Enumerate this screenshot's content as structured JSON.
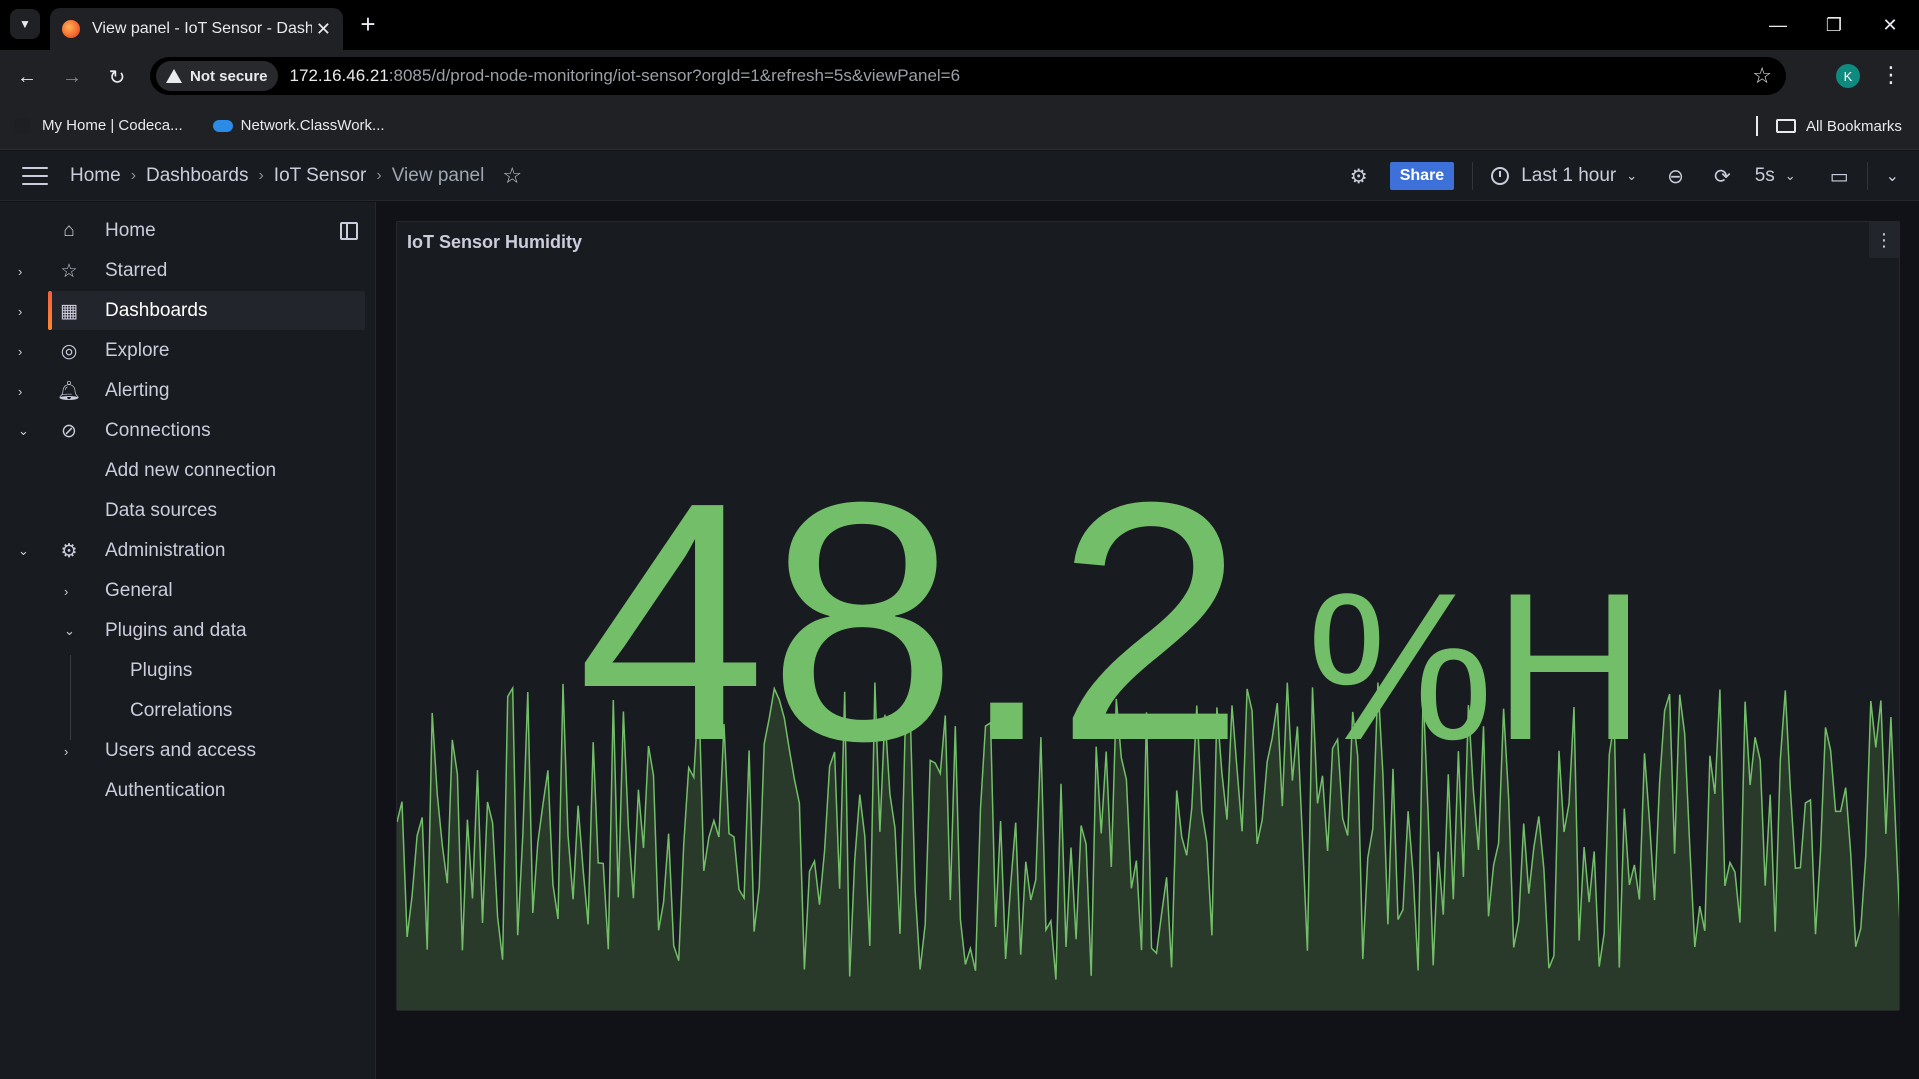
{
  "browser": {
    "tab_title": "View panel - IoT Sensor - Dashb",
    "url_host": "172.16.46.21",
    "url_rest": ":8085/d/prod-node-monitoring/iot-sensor?orgId=1&refresh=5s&viewPanel=6",
    "security_label": "Not secure",
    "profile_initial": "K",
    "bookmarks": [
      "My Home | Codeca...",
      "Network.ClassWork..."
    ],
    "all_bookmarks": "All Bookmarks"
  },
  "topnav": {
    "breadcrumbs": [
      "Home",
      "Dashboards",
      "IoT Sensor",
      "View panel"
    ],
    "share_label": "Share",
    "time_range": "Last 1 hour",
    "refresh_interval": "5s"
  },
  "sidebar": {
    "items": [
      {
        "label": "Home",
        "icon": "home-icon"
      },
      {
        "label": "Starred",
        "icon": "star-icon"
      },
      {
        "label": "Dashboards",
        "icon": "apps-icon",
        "active": true
      },
      {
        "label": "Explore",
        "icon": "compass-icon"
      },
      {
        "label": "Alerting",
        "icon": "bell-icon"
      },
      {
        "label": "Connections",
        "icon": "connections-icon"
      },
      {
        "label": "Add new connection"
      },
      {
        "label": "Data sources"
      },
      {
        "label": "Administration",
        "icon": "cog-icon"
      },
      {
        "label": "General"
      },
      {
        "label": "Plugins and data"
      },
      {
        "label": "Plugins"
      },
      {
        "label": "Correlations"
      },
      {
        "label": "Users and access"
      },
      {
        "label": "Authentication"
      }
    ]
  },
  "panel": {
    "title": "IoT Sensor Humidity",
    "value": "48.2",
    "unit": "%H",
    "color": "#73bf69",
    "sparkline_fill": "#2a3a2a"
  }
}
